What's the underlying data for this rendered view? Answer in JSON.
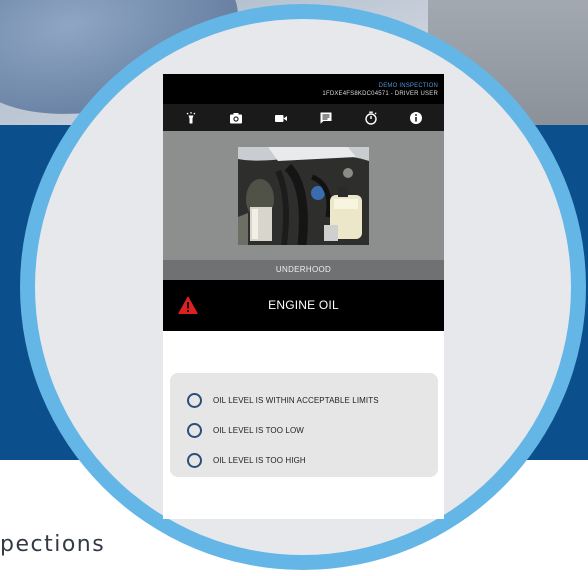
{
  "background": {
    "caption_fragment": "pections",
    "band_color": "#0b4f8c",
    "ring_color": "#64b6e6"
  },
  "app": {
    "status": {
      "mode": "DEMO INSPECTION",
      "vehicle_and_user": "1FDXE4FS8KDC04571 - DRIVER USER"
    },
    "toolbar": [
      {
        "icon": "flashlight-icon"
      },
      {
        "icon": "camera-icon"
      },
      {
        "icon": "video-camera-icon"
      },
      {
        "icon": "comment-icon"
      },
      {
        "icon": "timer-icon"
      },
      {
        "icon": "info-icon"
      }
    ],
    "photo_alt": "engine-bay-photo",
    "section": "UNDERHOOD",
    "question": {
      "title": "ENGINE OIL",
      "warning_icon": "warning-triangle-icon",
      "warning_color": "#e02020",
      "options": [
        {
          "label": "OIL LEVEL IS WITHIN ACCEPTABLE LIMITS",
          "selected": false
        },
        {
          "label": "OIL LEVEL IS TOO LOW",
          "selected": false
        },
        {
          "label": "OIL LEVEL IS TOO HIGH",
          "selected": false
        }
      ]
    }
  }
}
